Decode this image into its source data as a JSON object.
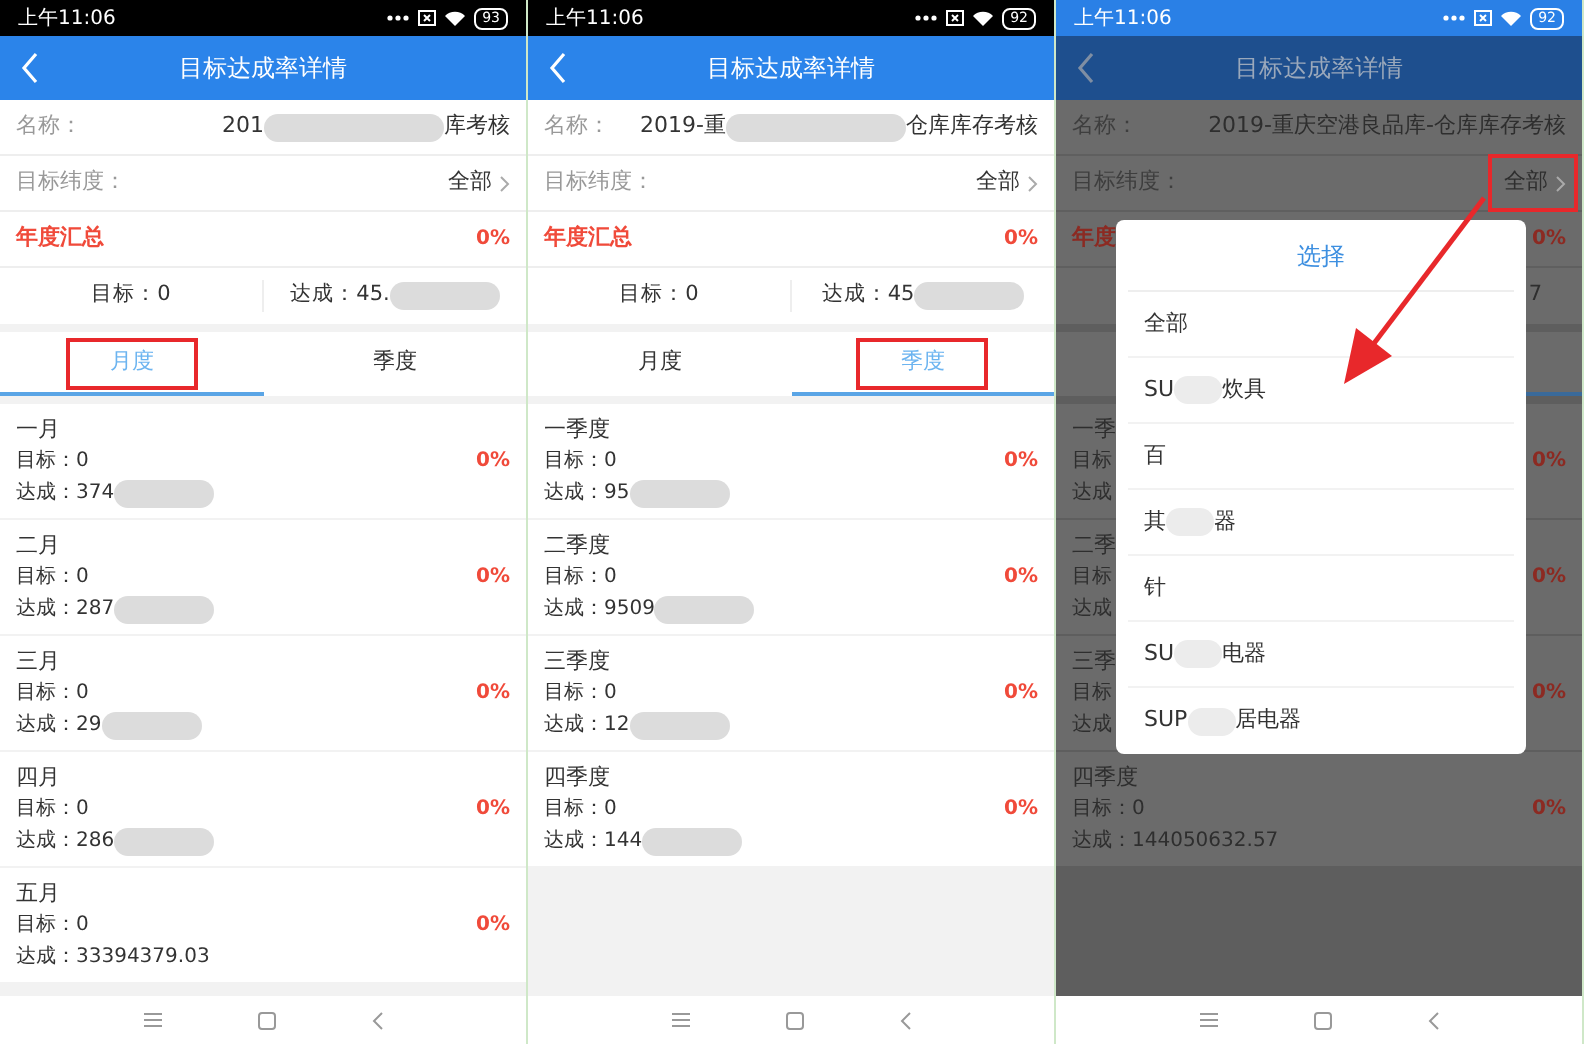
{
  "phones": [
    {
      "status": {
        "time": "上午11:06",
        "battery": "93"
      },
      "dimmed": false,
      "header": {
        "title": "目标达成率详情"
      },
      "name_row": {
        "label": "名称：",
        "value_start": "201",
        "value_end": "库考核"
      },
      "dimension_row": {
        "label": "目标纬度：",
        "value": "全部"
      },
      "summary": {
        "title": "年度汇总",
        "percent": "0%"
      },
      "totals": {
        "target": "目标：0",
        "achieved": "达成：45.",
        "blurred": true
      },
      "tabs": [
        {
          "label": "月度",
          "selected": true,
          "highlighted": true
        },
        {
          "label": "季度",
          "selected": false
        }
      ],
      "items": [
        {
          "title": "一月",
          "target": "目标：0",
          "achieved": "达成：374",
          "blurred": true,
          "percent": "0%"
        },
        {
          "title": "二月",
          "target": "目标：0",
          "achieved": "达成：287",
          "blurred": true,
          "percent": "0%"
        },
        {
          "title": "三月",
          "target": "目标：0",
          "achieved": "达成：29",
          "blurred": true,
          "percent": "0%"
        },
        {
          "title": "四月",
          "target": "目标：0",
          "achieved": "达成：286",
          "blurred": true,
          "percent": "0%"
        },
        {
          "title": "五月",
          "target": "目标：0",
          "achieved": "达成：33394379.03",
          "percent": "0%"
        }
      ]
    },
    {
      "status": {
        "time": "上午11:06",
        "battery": "92"
      },
      "dimmed": false,
      "header": {
        "title": "目标达成率详情"
      },
      "name_row": {
        "label": "名称：",
        "value_start": "2019-重",
        "value_end": "仓库库存考核"
      },
      "dimension_row": {
        "label": "目标纬度：",
        "value": "全部"
      },
      "summary": {
        "title": "年度汇总",
        "percent": "0%"
      },
      "totals": {
        "target": "目标：0",
        "achieved": "达成：45",
        "blurred": true
      },
      "tabs": [
        {
          "label": "月度",
          "selected": false
        },
        {
          "label": "季度",
          "selected": true,
          "highlighted": true
        }
      ],
      "items": [
        {
          "title": "一季度",
          "target": "目标：0",
          "achieved": "达成：95",
          "blurred": true,
          "percent": "0%"
        },
        {
          "title": "二季度",
          "target": "目标：0",
          "achieved": "达成：9509",
          "blurred": true,
          "percent": "0%"
        },
        {
          "title": "三季度",
          "target": "目标：0",
          "achieved": "达成：12",
          "blurred": true,
          "percent": "0%"
        },
        {
          "title": "四季度",
          "target": "目标：0",
          "achieved": "达成：144",
          "blurred": true,
          "percent": "0%"
        }
      ]
    },
    {
      "status": {
        "time": "上午11:06",
        "battery": "92"
      },
      "dimmed": true,
      "header": {
        "title": "目标达成率详情"
      },
      "name_row": {
        "label": "名称：",
        "value": "2019-重庆空港良品库-仓库库存考核"
      },
      "dimension_row": {
        "label": "目标纬度：",
        "value": "全部",
        "highlighted": true
      },
      "summary": {
        "title": "年度",
        "percent": "0%"
      },
      "totals": {
        "tail": "7"
      },
      "items": [
        {
          "title": "一季",
          "target": "目标",
          "achieved": "达成",
          "percent": "0%"
        },
        {
          "title": "二季",
          "target": "目标",
          "achieved": "达成",
          "percent": "0%"
        },
        {
          "title": "三季",
          "target": "目标",
          "achieved": "达成",
          "percent": "0%"
        },
        {
          "title": "四季度",
          "target": "目标：0",
          "achieved": "达成：144050632.57",
          "percent": "0%"
        }
      ],
      "dialog": {
        "title": "选择",
        "options": [
          {
            "before": "全部"
          },
          {
            "before": "SU",
            "after": "炊具"
          },
          {
            "before": "百"
          },
          {
            "before": "其",
            "after": "器"
          },
          {
            "before": "针"
          },
          {
            "before": "SU",
            "after": "电器"
          },
          {
            "before": "SUP",
            "after": "居电器"
          }
        ]
      },
      "annotation_arrow": true
    }
  ]
}
